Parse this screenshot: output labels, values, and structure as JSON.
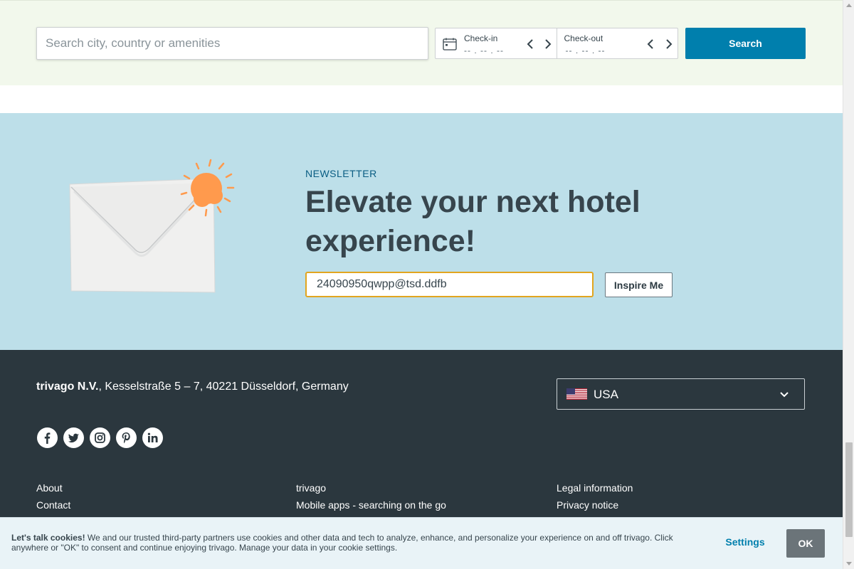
{
  "search": {
    "placeholder": "Search city, country or amenities",
    "checkin_label": "Check-in",
    "checkin_value": "-- . -- . --",
    "checkout_label": "Check-out",
    "checkout_value": "-- . -- . --",
    "button_label": "Search"
  },
  "newsletter": {
    "kicker": "NEWSLETTER",
    "title": "Elevate your next hotel experience!",
    "email_value": "24090950qwpp@tsd.ddfb",
    "button_label": "Inspire Me"
  },
  "footer": {
    "company": "trivago N.V.",
    "address": ", Kesselstraße 5 – 7, 40221 Düsseldorf, Germany",
    "country": "USA",
    "socials": [
      "facebook-icon",
      "twitter-icon",
      "instagram-icon",
      "pinterest-icon",
      "linkedin-icon"
    ],
    "col1": [
      "About",
      "Contact"
    ],
    "col2": [
      "trivago",
      "Mobile apps - searching on the go"
    ],
    "col3": [
      "Legal information",
      "Privacy notice"
    ]
  },
  "cookie": {
    "heading": "Let's talk cookies!",
    "body": " We and our trusted third-party partners use cookies and other data and tech to analyze, enhance, and personalize your experience on and off trivago. Click anywhere or \"OK\" to consent and continue enjoying trivago. Manage your data in your cookie settings.",
    "settings_label": "Settings",
    "ok_label": "OK"
  },
  "colors": {
    "accent": "#007fad",
    "footer_bg": "#2b373e",
    "newsletter_bg": "#bddfe9",
    "search_band_bg": "#f2f8ec",
    "email_focus": "#e2a51f"
  }
}
